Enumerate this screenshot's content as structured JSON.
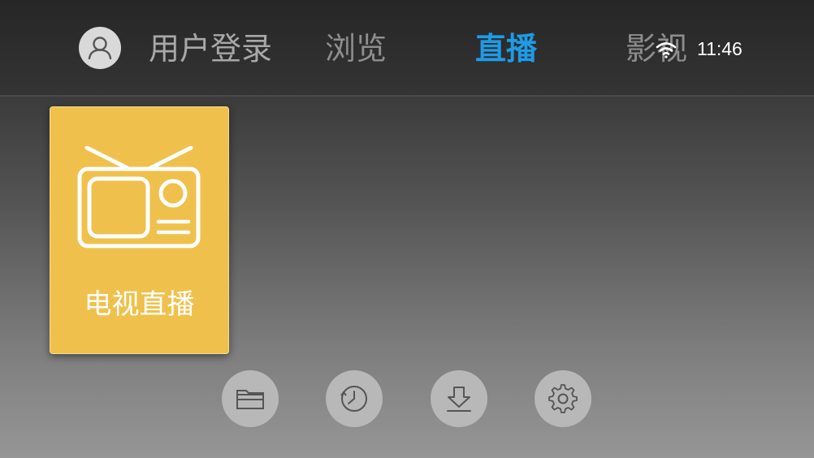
{
  "header": {
    "nav": {
      "login": "用户登录",
      "browse": "浏览",
      "live": "直播",
      "movies": "影视"
    },
    "status": {
      "time": "11:46",
      "wifi_icon": "wifi-icon"
    },
    "active_color": "#1e9be6"
  },
  "main": {
    "tile": {
      "label": "电视直播",
      "icon": "tv-icon",
      "color": "#efc14c"
    }
  },
  "bottom_buttons": [
    {
      "icon": "folder-icon"
    },
    {
      "icon": "history-clock-icon"
    },
    {
      "icon": "download-icon"
    },
    {
      "icon": "gear-icon"
    }
  ]
}
